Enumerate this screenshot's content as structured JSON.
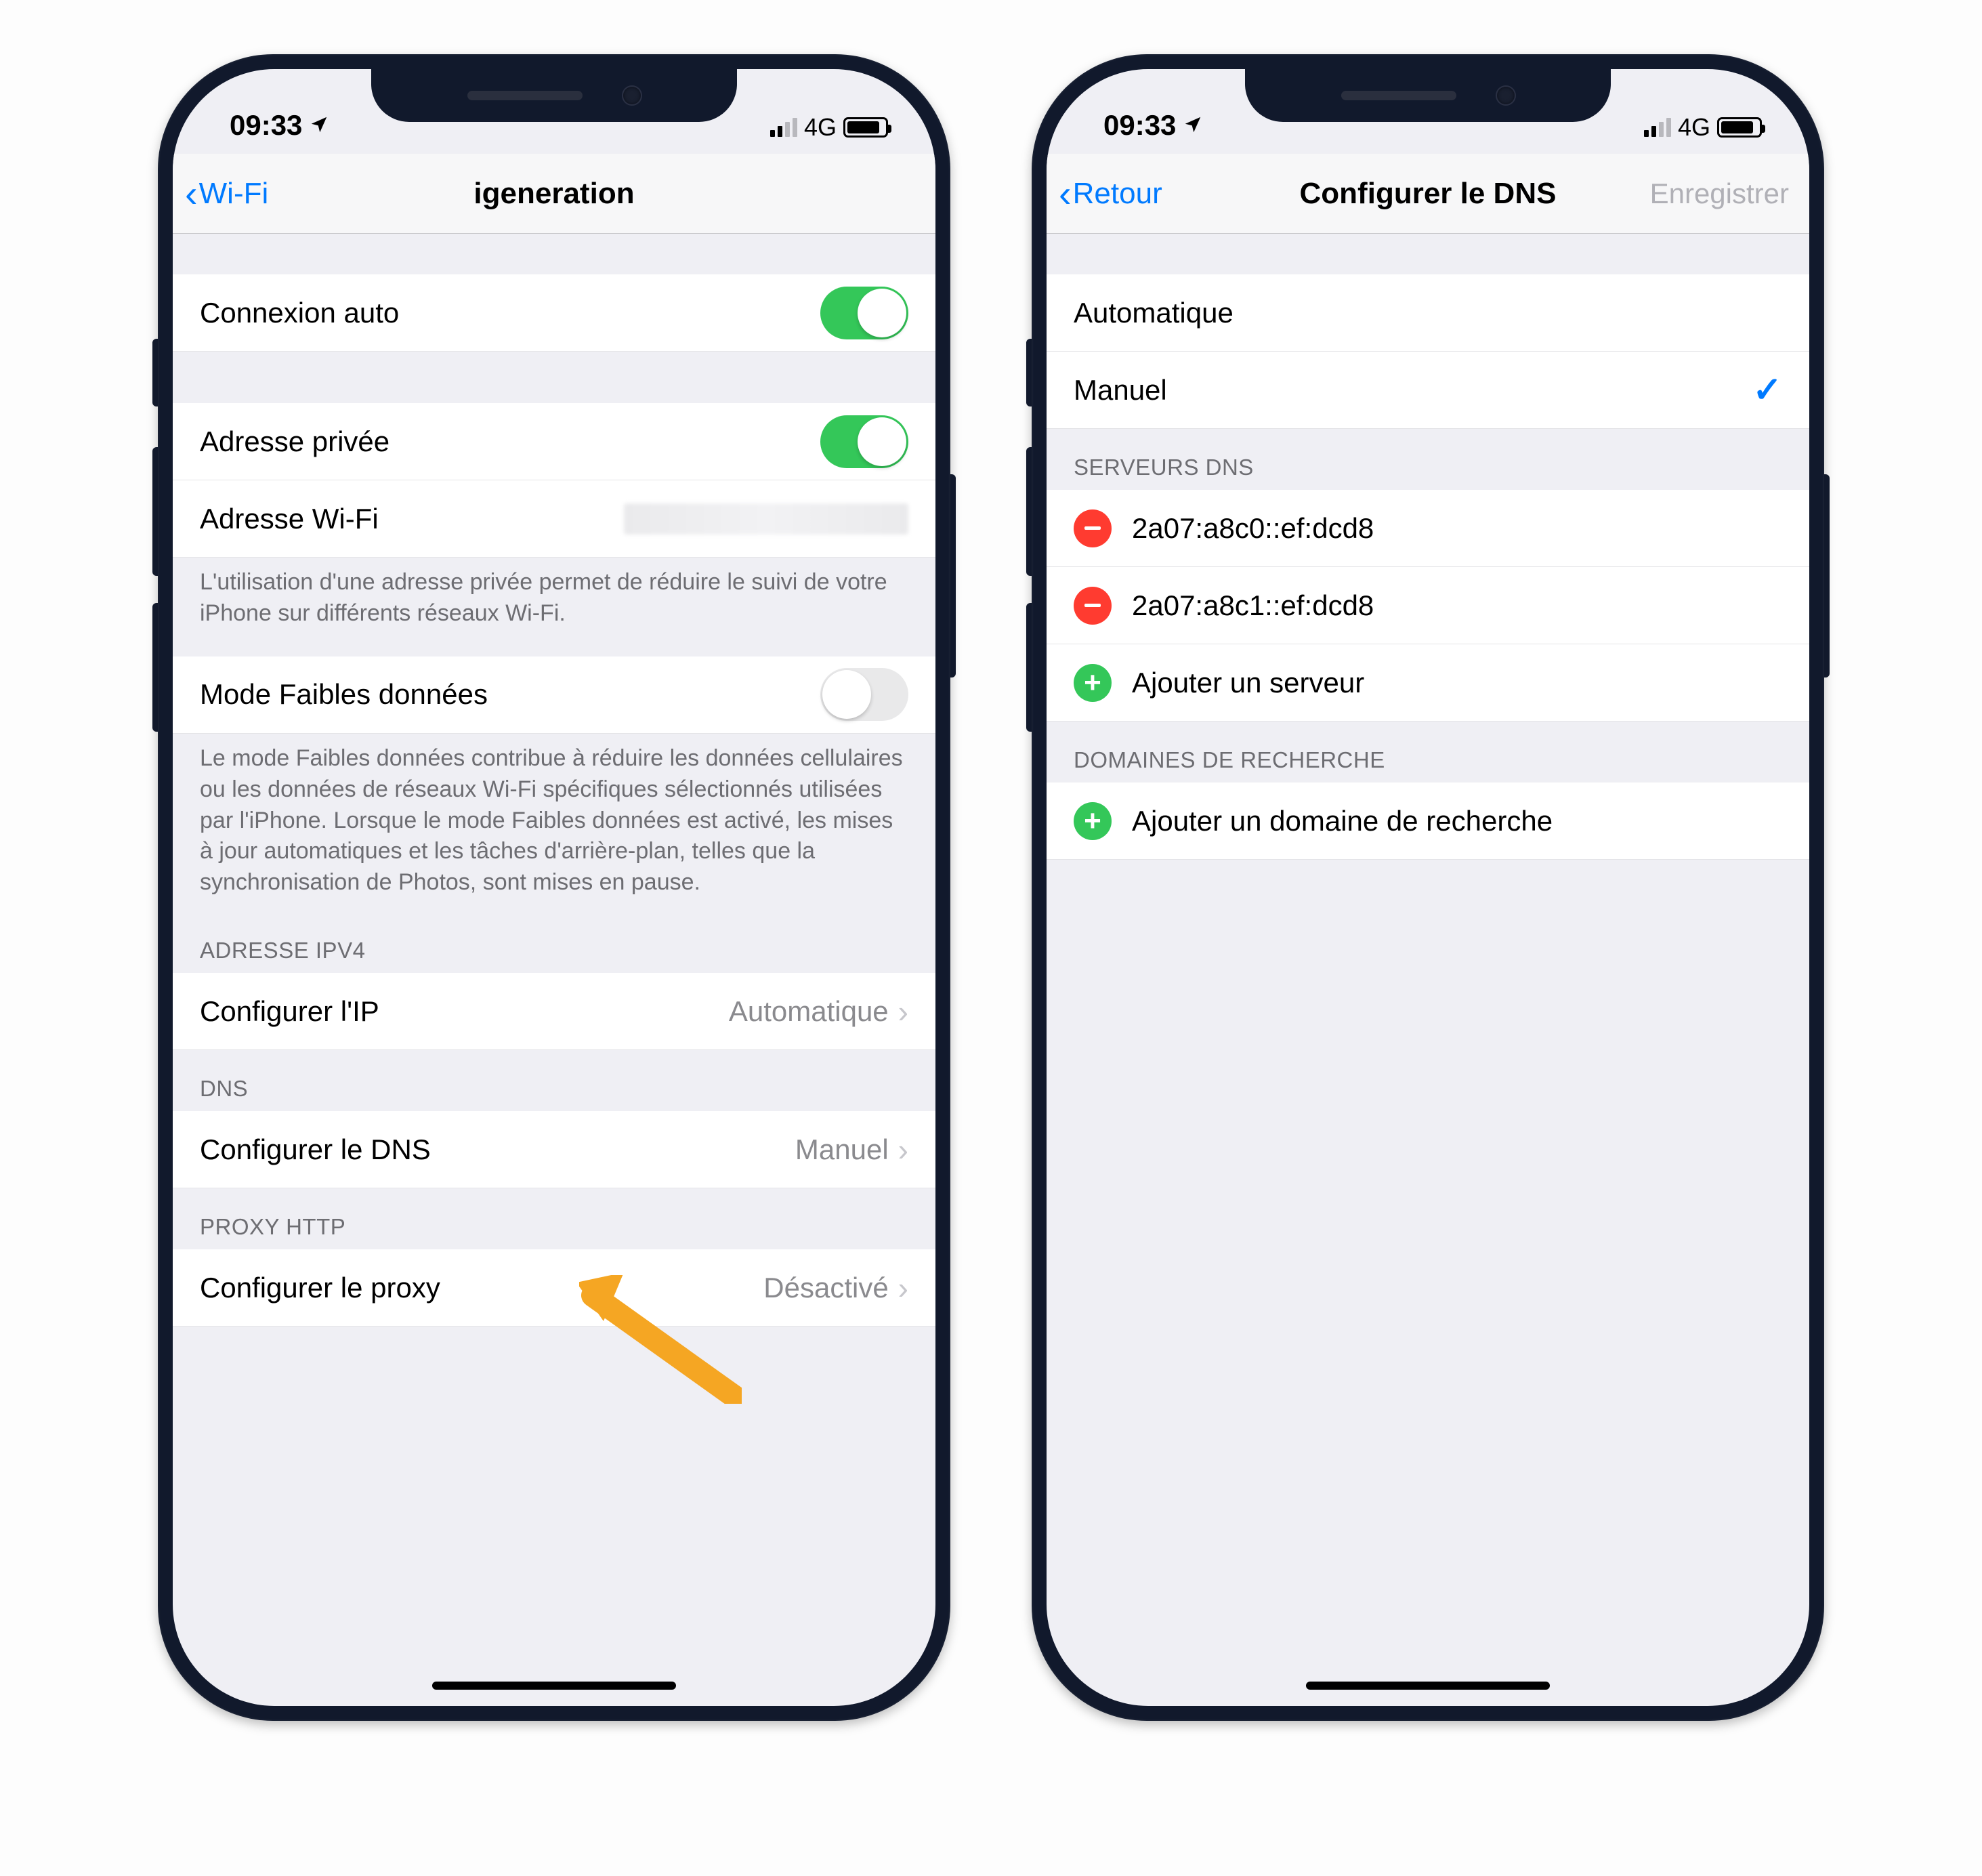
{
  "statusbar": {
    "time": "09:33",
    "net": "4G"
  },
  "left": {
    "back": "Wi-Fi",
    "title": "igeneration",
    "rows": {
      "auto_conn": "Connexion auto",
      "priv_addr": "Adresse privée",
      "wifi_addr": "Adresse Wi-Fi",
      "priv_foot": "L'utilisation d'une adresse privée permet de réduire le suivi de votre iPhone sur différents réseaux Wi-Fi.",
      "lowdata": "Mode Faibles données",
      "lowdata_foot": "Le mode Faibles données contribue à réduire les données cellulaires ou les données de réseaux Wi-Fi spécifiques sélectionnés utilisées par l'iPhone. Lorsque le mode Faibles données est activé, les mises à jour automatiques et les tâches d'arrière-plan, telles que la synchronisation de Photos, sont mises en pause.",
      "ipv4_header": "ADRESSE IPV4",
      "conf_ip": "Configurer l'IP",
      "conf_ip_val": "Automatique",
      "dns_header": "DNS",
      "conf_dns": "Configurer le DNS",
      "conf_dns_val": "Manuel",
      "proxy_header": "PROXY HTTP",
      "conf_proxy": "Configurer le proxy",
      "conf_proxy_val": "Désactivé"
    }
  },
  "right": {
    "back": "Retour",
    "title": "Configurer le DNS",
    "save": "Enregistrer",
    "auto": "Automatique",
    "manual": "Manuel",
    "servers_header": "SERVEURS DNS",
    "server1": "2a07:a8c0::ef:dcd8",
    "server2": "2a07:a8c1::ef:dcd8",
    "add_server": "Ajouter un serveur",
    "search_header": "DOMAINES DE RECHERCHE",
    "add_domain": "Ajouter un domaine de recherche"
  },
  "colors": {
    "tint": "#007aff",
    "green": "#34c759",
    "red": "#ff3b30",
    "orange": "#f5a623"
  }
}
